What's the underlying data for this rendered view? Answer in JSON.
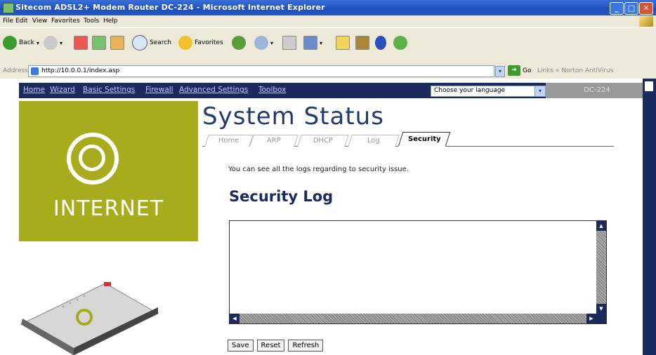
{
  "window": {
    "title": "Sitecom ADSL2+ Modem Router DC-224 - Microsoft Internet Explorer",
    "controls": [
      "minimize",
      "maximize",
      "close"
    ]
  },
  "menu": {
    "items": [
      "File",
      "Edit",
      "View",
      "Favorites",
      "Tools",
      "Help"
    ]
  },
  "toolbar": {
    "back_label": "Back",
    "search_label": "Search",
    "favorites_label": "Favorites"
  },
  "address": {
    "label": "Address",
    "url": "http://10.0.0.1/index.asp",
    "go_label": "Go",
    "links_label": "Links",
    "extra_label": "Norton AntiVirus"
  },
  "nav": {
    "links": [
      "Home",
      "Wizard",
      "Basic Settings",
      "Firewall",
      "Advanced Settings",
      "Toolbox"
    ],
    "language_select": "Choose your language",
    "model": "DC-224"
  },
  "brand": {
    "logo_text": "INTERNET"
  },
  "page": {
    "title": "System Status",
    "tabs": [
      {
        "label": "Home",
        "active": false
      },
      {
        "label": "ARP",
        "active": false
      },
      {
        "label": "DHCP",
        "active": false
      },
      {
        "label": "Log",
        "active": false
      },
      {
        "label": "Security",
        "active": true
      }
    ],
    "description": "You can see all the logs regarding to security issue.",
    "section_title": "Security Log",
    "log_content": ""
  },
  "buttons": {
    "save": "Save",
    "reset": "Reset",
    "refresh": "Refresh"
  },
  "colors": {
    "nav_bg": "#1b2a5c",
    "logo_green": "#a6ac1c",
    "title_blue": "#233a6a"
  }
}
